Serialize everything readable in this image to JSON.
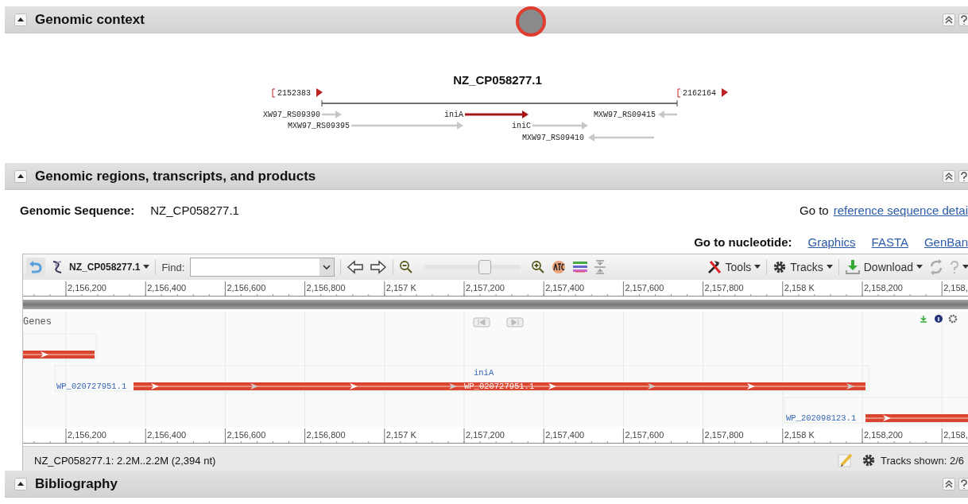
{
  "sections": [
    {
      "title": "Genomic context"
    },
    {
      "title": "Genomic regions, transcripts, and products"
    },
    {
      "title": "Bibliography"
    }
  ],
  "genomic_context": {
    "accession": "NZ_CP058277.1",
    "start": "2152383",
    "end": "2162164",
    "genes": [
      {
        "label": "XW97_RS09390",
        "kind": "forward",
        "highlighted": false
      },
      {
        "label": "iniA",
        "kind": "forward",
        "highlighted": true
      },
      {
        "label": "MXW97_RS09415",
        "kind": "reverse",
        "highlighted": false
      },
      {
        "label": "MXW97_RS09395",
        "kind": "forward",
        "highlighted": false
      },
      {
        "label": "iniC",
        "kind": "forward",
        "highlighted": false
      },
      {
        "label": "MXW97_RS09410",
        "kind": "reverse",
        "highlighted": false
      }
    ]
  },
  "genomic_sequence": {
    "label": "Genomic Sequence:",
    "value": "NZ_CP058277.1",
    "goto_prefix": "Go to",
    "goto_link": "reference sequence detai"
  },
  "nucleotide_links": {
    "label": "Go to nucleotide:",
    "links": [
      "Graphics",
      "FASTA",
      "GenBan"
    ]
  },
  "viewer": {
    "sequence": "NZ_CP058277.1",
    "find_label": "Find:",
    "zoom": {
      "level": 0.63
    },
    "menus": [
      "Tools",
      "Tracks",
      "Download"
    ],
    "top_ruler": [
      "2,156,200",
      "2,156,400",
      "2,156,600",
      "2,156,800",
      "2,157 K",
      "2,157,200",
      "2,157,400",
      "2,157,600",
      "2,157,800",
      "2,158 K",
      "2,158,200",
      "2,158,"
    ],
    "track": {
      "name": "Genes",
      "features": [
        {
          "kind": "unlabeled"
        },
        {
          "kind": "labeled",
          "label": "WP_020727951.1",
          "gene": "iniA",
          "inner_label": "WP_020727951.1"
        },
        {
          "kind": "labeled",
          "label": "WP_202098123.1"
        }
      ]
    },
    "bottom_ruler": [
      "2,156,200",
      "2,156,400",
      "2,156,600",
      "2,156,800",
      "2,157 K",
      "2,157,200",
      "2,157,400",
      "2,157,600",
      "2,157,800",
      "2,158 K",
      "2,158,200",
      "2,158,"
    ],
    "status": "NZ_CP058277.1: 2.2M..2.2M (2,394 nt)",
    "tracks_shown": "Tracks shown: 2/6"
  }
}
